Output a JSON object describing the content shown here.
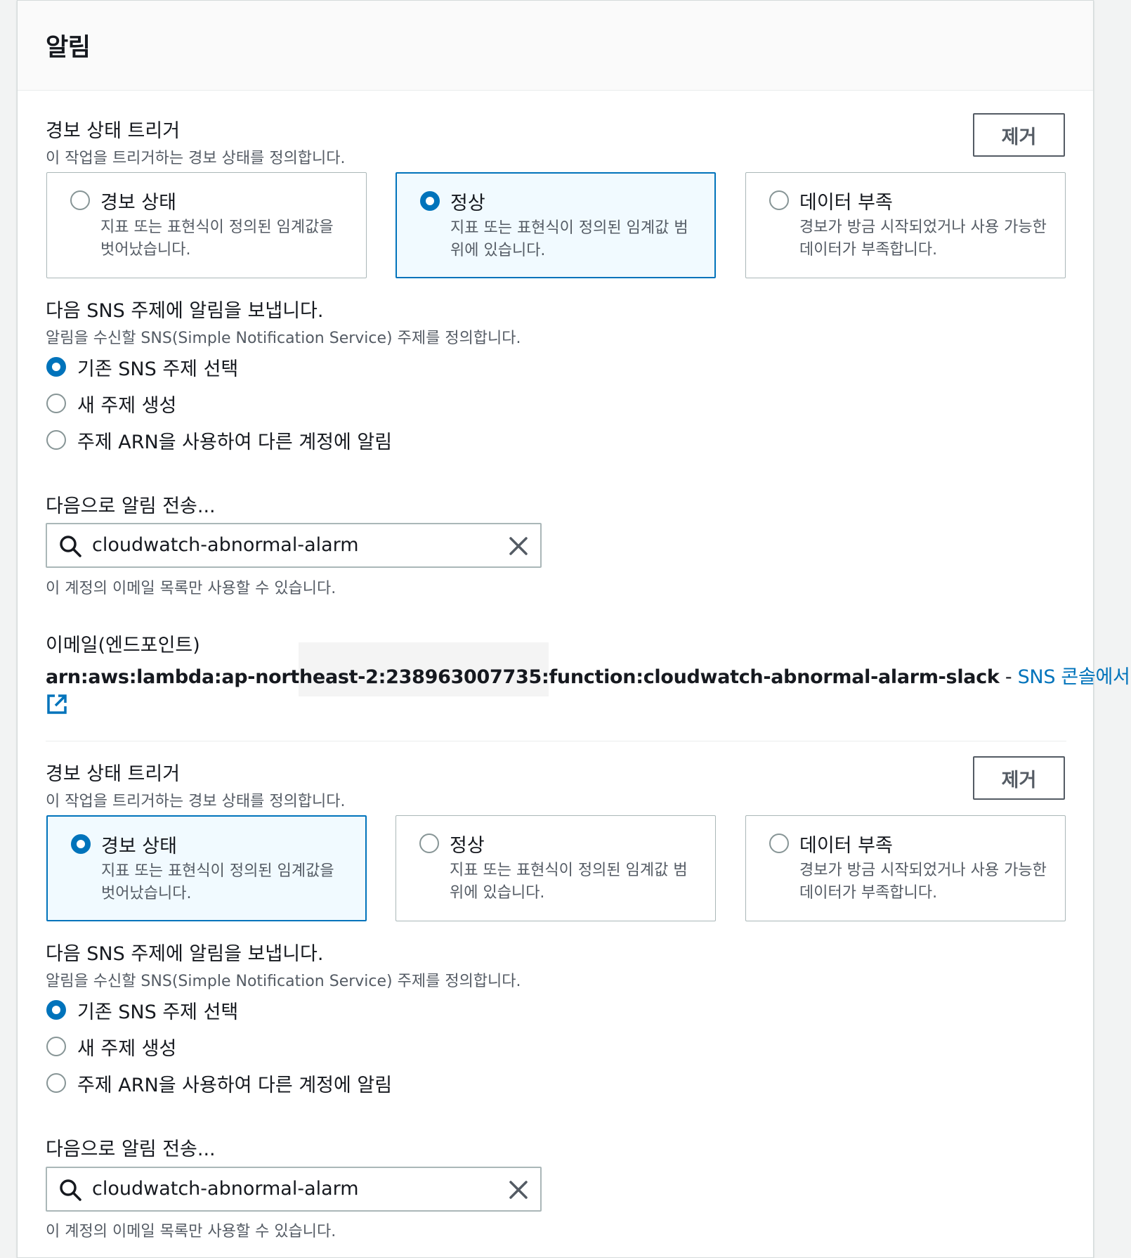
{
  "panel": {
    "title": "알림"
  },
  "sections": [
    {
      "trigger_label": "경보 상태 트리거",
      "trigger_desc": "이 작업을 트리거하는 경보 상태를 정의합니다.",
      "remove_label": "제거",
      "states": [
        {
          "title": "경보 상태",
          "desc": "지표 또는 표현식이 정의된 임계값을 벗어났습니다.",
          "selected": false
        },
        {
          "title": "정상",
          "desc": "지표 또는 표현식이 정의된 임계값 범위에 있습니다.",
          "selected": true
        },
        {
          "title": "데이터 부족",
          "desc": "경보가 방금 시작되었거나 사용 가능한 데이터가 부족합니다.",
          "selected": false
        }
      ],
      "sns_label": "다음 SNS 주제에 알림을 보냅니다.",
      "sns_desc": "알림을 수신할 SNS(Simple Notification Service) 주제를 정의합니다.",
      "sns_options": [
        {
          "label": "기존 SNS 주제 선택",
          "checked": true
        },
        {
          "label": "새 주제 생성",
          "checked": false
        },
        {
          "label": "주제 ARN을 사용하여 다른 계정에 알림",
          "checked": false
        }
      ],
      "send_to_label": "다음으로 알림 전송...",
      "send_to_value": "cloudwatch-abnormal-alarm",
      "send_to_hint": "이 계정의 이메일 목록만 사용할 수 있습니다.",
      "endpoint_label": "이메일(엔드포인트)",
      "endpoint_arn": "arn:aws:lambda:ap-northeast-2:238963007735:function:cloudwatch-abnormal-alarm-slack",
      "endpoint_sep": " - ",
      "console_link": "SNS 콘솔에서 보기"
    },
    {
      "trigger_label": "경보 상태 트리거",
      "trigger_desc": "이 작업을 트리거하는 경보 상태를 정의합니다.",
      "remove_label": "제거",
      "states": [
        {
          "title": "경보 상태",
          "desc": "지표 또는 표현식이 정의된 임계값을 벗어났습니다.",
          "selected": true
        },
        {
          "title": "정상",
          "desc": "지표 또는 표현식이 정의된 임계값 범위에 있습니다.",
          "selected": false
        },
        {
          "title": "데이터 부족",
          "desc": "경보가 방금 시작되었거나 사용 가능한 데이터가 부족합니다.",
          "selected": false
        }
      ],
      "sns_label": "다음 SNS 주제에 알림을 보냅니다.",
      "sns_desc": "알림을 수신할 SNS(Simple Notification Service) 주제를 정의합니다.",
      "sns_options": [
        {
          "label": "기존 SNS 주제 선택",
          "checked": true
        },
        {
          "label": "새 주제 생성",
          "checked": false
        },
        {
          "label": "주제 ARN을 사용하여 다른 계정에 알림",
          "checked": false
        }
      ],
      "send_to_label": "다음으로 알림 전송...",
      "send_to_value": "cloudwatch-abnormal-alarm",
      "send_to_hint": "이 계정의 이메일 목록만 사용할 수 있습니다."
    }
  ],
  "icons": {
    "search": "search-icon",
    "clear": "close-icon",
    "external": "external-link-icon"
  },
  "colors": {
    "accent": "#0073bb",
    "selected_bg": "#f1faff",
    "border": "#aab7b8"
  }
}
